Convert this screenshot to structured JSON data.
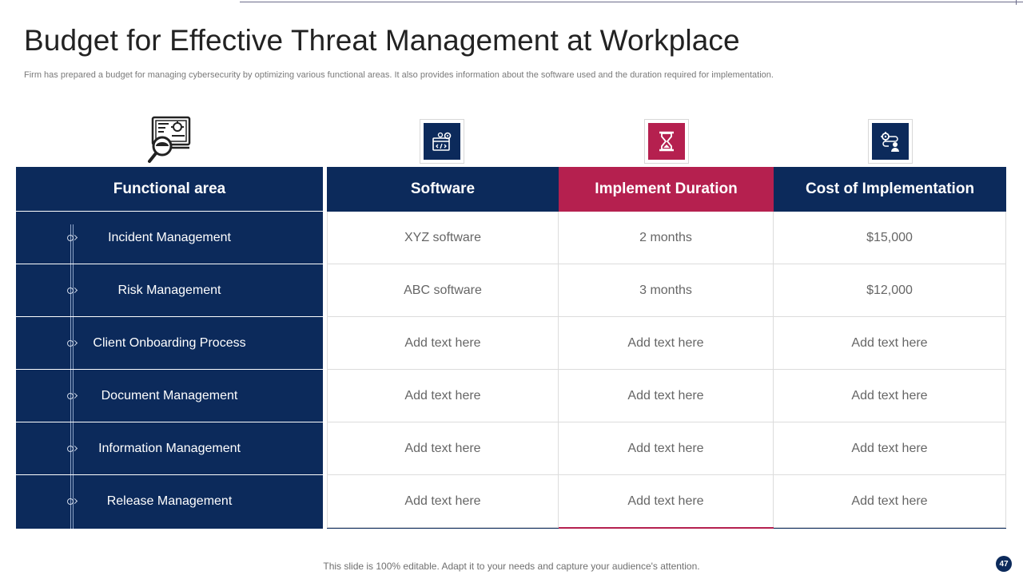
{
  "title": "Budget for Effective Threat Management at Workplace",
  "subtitle": "Firm has prepared a budget for managing cybersecurity by optimizing various functional areas. It also provides information about the software used and the duration required for implementation.",
  "colors": {
    "navy": "#0c2a5b",
    "crimson": "#b5204f"
  },
  "icons": {
    "hero": "computer-threat-magnifier-icon",
    "software": "software-code-gear-icon",
    "duration": "hourglass-icon",
    "cost": "gear-person-process-icon"
  },
  "table": {
    "headers": {
      "functional_area": "Functional area",
      "software": "Software",
      "duration": "Implement Duration",
      "cost": "Cost of Implementation"
    },
    "rows": [
      {
        "area": "Incident Management",
        "software": "XYZ software",
        "duration": "2 months",
        "cost": "$15,000"
      },
      {
        "area": "Risk Management",
        "software": "ABC software",
        "duration": "3 months",
        "cost": "$12,000"
      },
      {
        "area": "Client Onboarding Process",
        "software": "Add text here",
        "duration": "Add text here",
        "cost": "Add text here"
      },
      {
        "area": "Document Management",
        "software": "Add text here",
        "duration": "Add text here",
        "cost": "Add text here"
      },
      {
        "area": "Information Management",
        "software": "Add text here",
        "duration": "Add text here",
        "cost": "Add text here"
      },
      {
        "area": "Release Management",
        "software": "Add text here",
        "duration": "Add text here",
        "cost": "Add text here"
      }
    ]
  },
  "footer": "This slide is 100% editable. Adapt it to your needs and capture your audience's attention.",
  "page_number": "47"
}
